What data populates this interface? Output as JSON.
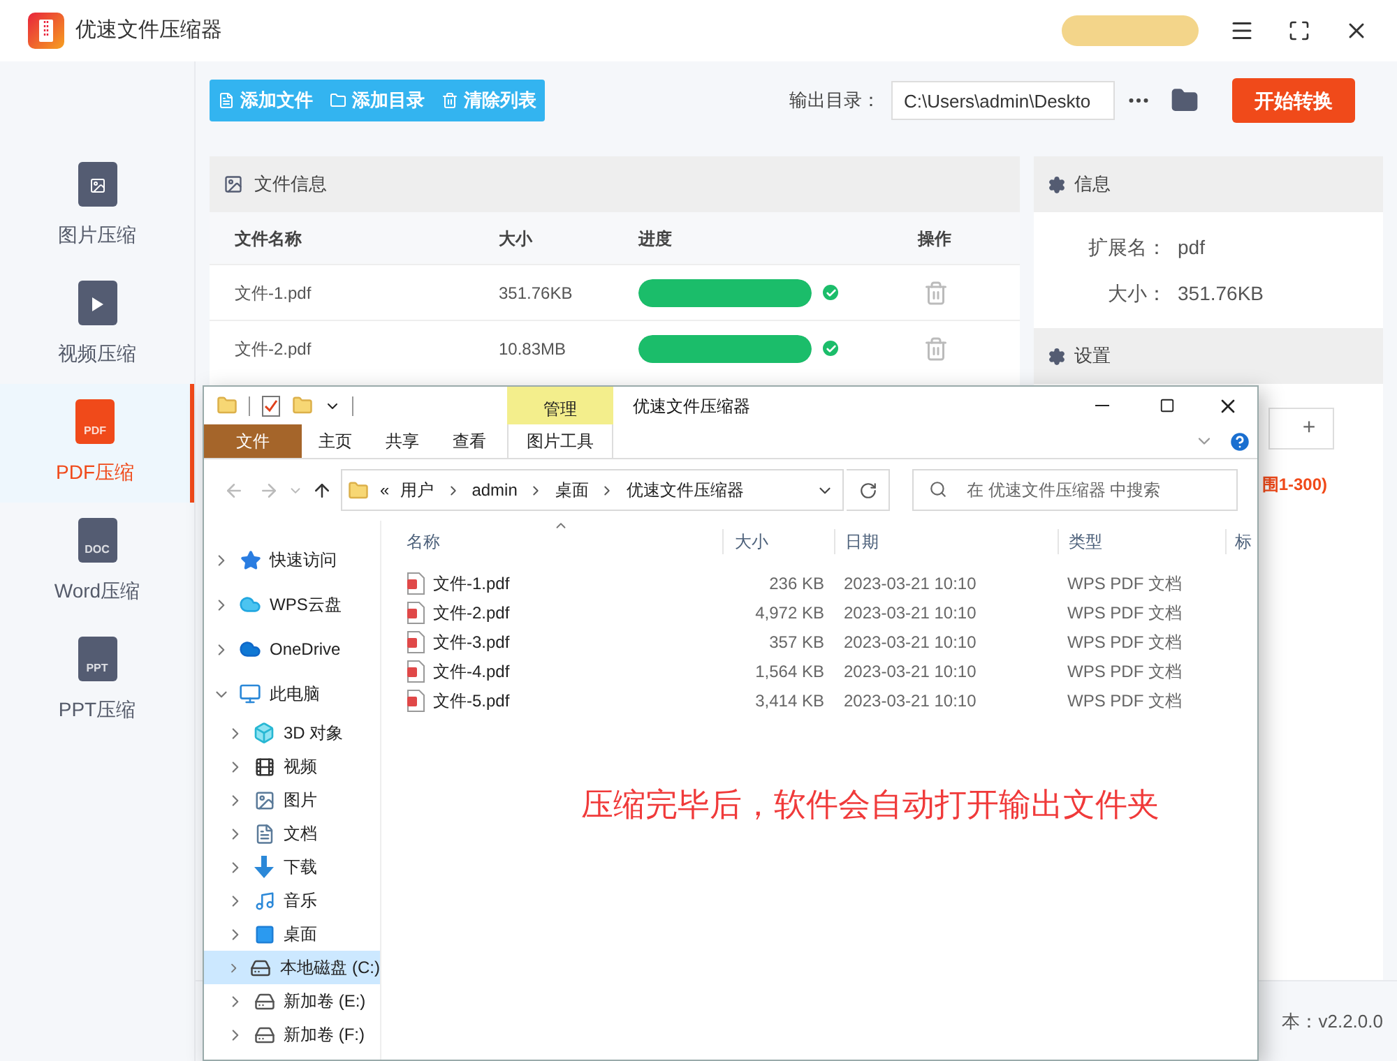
{
  "app": {
    "title": "优速文件压缩器"
  },
  "sidebar": {
    "items": [
      {
        "kind": "image",
        "label": "图片压缩",
        "selected": false
      },
      {
        "kind": "video",
        "label": "视频压缩",
        "selected": false
      },
      {
        "kind": "badge",
        "badge": "PDF",
        "label": "PDF压缩",
        "selected": true
      },
      {
        "kind": "badge",
        "badge": "DOC",
        "label": "Word压缩",
        "selected": false
      },
      {
        "kind": "badge",
        "badge": "PPT",
        "label": "PPT压缩",
        "selected": false
      }
    ]
  },
  "toolbar": {
    "buttons": [
      {
        "kind": "file",
        "label": "添加文件"
      },
      {
        "kind": "folder",
        "label": "添加目录"
      },
      {
        "kind": "trash",
        "label": "清除列表"
      }
    ],
    "output_label": "输出目录：",
    "output_path": "C:\\Users\\admin\\Deskto",
    "start_button": "开始转换"
  },
  "file_panel": {
    "title": "文件信息",
    "columns": [
      "文件名称",
      "大小",
      "进度",
      "操作"
    ],
    "rows": [
      {
        "name": "文件-1.pdf",
        "size": "351.76KB",
        "level": 1,
        "done": true
      },
      {
        "name": "文件-2.pdf",
        "size": "10.83MB",
        "level": 1,
        "done": true
      }
    ]
  },
  "info_panel": {
    "title": "信息",
    "fields": [
      {
        "label": "扩展名：",
        "value": "pdf"
      },
      {
        "label": "大小：",
        "value": "351.76KB"
      }
    ]
  },
  "settings_panel": {
    "title": "设置",
    "stepper_plus": "+",
    "hint": "围1-300)"
  },
  "version": "本：v2.2.0.0",
  "explorer": {
    "title": "优速文件压缩器",
    "context_group": "管理",
    "ribbon_tabs": [
      {
        "kind": "file",
        "label": "文件"
      },
      {
        "kind": "tab",
        "label": "主页"
      },
      {
        "kind": "tab",
        "label": "共享"
      },
      {
        "kind": "tab",
        "label": "查看"
      },
      {
        "kind": "context",
        "label": "图片工具"
      }
    ],
    "breadcrumb_overflow": "«",
    "breadcrumb": [
      "用户",
      "admin",
      "桌面",
      "优速文件压缩器"
    ],
    "search_placeholder": "在 优速文件压缩器 中搜索",
    "nav_tree": [
      {
        "label": "快速访问",
        "expanded": false,
        "selected": false
      },
      {
        "label": "WPS云盘",
        "expanded": false,
        "selected": false
      },
      {
        "label": "OneDrive",
        "expanded": false,
        "selected": false
      },
      {
        "label": "此电脑",
        "expanded": true,
        "selected": false,
        "children": [
          {
            "label": "3D 对象",
            "expanded": false,
            "selected": false
          },
          {
            "label": "视频",
            "expanded": false,
            "selected": false
          },
          {
            "label": "图片",
            "expanded": false,
            "selected": false
          },
          {
            "label": "文档",
            "expanded": false,
            "selected": false
          },
          {
            "label": "下载",
            "expanded": false,
            "selected": false
          },
          {
            "label": "音乐",
            "expanded": false,
            "selected": false
          },
          {
            "label": "桌面",
            "expanded": false,
            "selected": false
          },
          {
            "label": "本地磁盘 (C:)",
            "expanded": false,
            "selected": true
          },
          {
            "label": "新加卷 (E:)",
            "expanded": false,
            "selected": false
          },
          {
            "label": "新加卷 (F:)",
            "expanded": false,
            "selected": false
          }
        ]
      }
    ],
    "columns": [
      "名称",
      "大小",
      "日期",
      "类型",
      "标"
    ],
    "files": [
      {
        "name": "文件-1.pdf",
        "size": "236 KB",
        "date": "2023-03-21 10:10",
        "type": "WPS PDF 文档"
      },
      {
        "name": "文件-2.pdf",
        "size": "4,972 KB",
        "date": "2023-03-21 10:10",
        "type": "WPS PDF 文档"
      },
      {
        "name": "文件-3.pdf",
        "size": "357 KB",
        "date": "2023-03-21 10:10",
        "type": "WPS PDF 文档"
      },
      {
        "name": "文件-4.pdf",
        "size": "1,564 KB",
        "date": "2023-03-21 10:10",
        "type": "WPS PDF 文档"
      },
      {
        "name": "文件-5.pdf",
        "size": "3,414 KB",
        "date": "2023-03-21 10:10",
        "type": "WPS PDF 文档"
      }
    ],
    "annotation": "压缩完毕后，软件会自动打开输出文件夹"
  }
}
